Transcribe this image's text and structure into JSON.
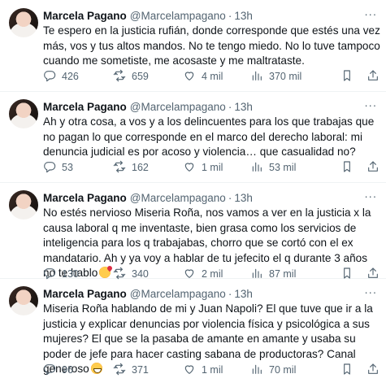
{
  "tweets": [
    {
      "name": "Marcela Pagano",
      "handle": "@Marcelampagano",
      "separator": "·",
      "time": "13h",
      "text": "Te espero en la justicia rufián, donde corresponde que estés una vez más, vos y tus altos mandos. No te tengo miedo. No lo tuve tampoco cuando me sometiste, me acosaste y me maltrataste.",
      "emoji": "",
      "replies": "426",
      "retweets": "659",
      "likes": "4 mil",
      "views": "370 mil"
    },
    {
      "name": "Marcela Pagano",
      "handle": "@Marcelampagano",
      "separator": "·",
      "time": "13h",
      "text": "Ah y otra cosa, a vos y a los delincuentes para los que trabajas que no pagan lo que corresponde en el marco del derecho laboral: mi denuncia judicial es por acoso y violencia… que casualidad no?",
      "emoji": "",
      "replies": "53",
      "retweets": "162",
      "likes": "1 mil",
      "views": "53 mil"
    },
    {
      "name": "Marcela Pagano",
      "handle": "@Marcelampagano",
      "separator": "·",
      "time": "13h",
      "text": "No estés nervioso Miseria Roña, nos vamos a ver en la justicia x la causa laboral q me inventaste, bien grasa como los servicios de inteligencia para los q trabajabas, chorro que se cortó con el ex mandatario. Ah y ya voy a hablar de tu jefecito el q durante 3 años no te hablo",
      "emoji": "kiss",
      "replies": "130",
      "retweets": "340",
      "likes": "2 mil",
      "views": "87 mil"
    },
    {
      "name": "Marcela Pagano",
      "handle": "@Marcelampagano",
      "separator": "·",
      "time": "13h",
      "text": "Miseria Roña hablando de mi y Juan Napoli? El que tuve que ir a la justicia y explicar denuncias por violencia física y psicológica a sus mujeres? El que se la pasaba de amante en amante y usaba su poder de jefe para hacer casting sabana de productoras? Canal generoso",
      "emoji": "grin",
      "replies": "96",
      "retweets": "371",
      "likes": "1 mil",
      "views": "70 mil"
    }
  ],
  "icons": {
    "reply": "reply-icon",
    "retweet": "retweet-icon",
    "like": "heart-icon",
    "views": "views-chart-icon",
    "bookmark": "bookmark-icon",
    "share": "share-icon",
    "more": "more-icon"
  },
  "colors": {
    "text": "#0f1419",
    "secondary": "#536471",
    "divider": "#eff3f4"
  }
}
